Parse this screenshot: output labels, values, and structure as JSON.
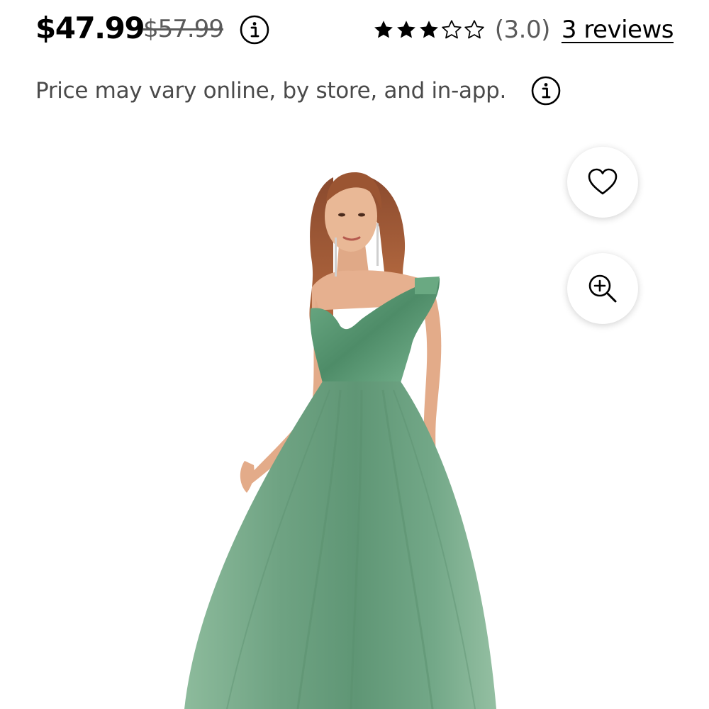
{
  "price": {
    "current": "$47.99",
    "was": "$57.99"
  },
  "rating": {
    "value": 3.0,
    "max": 5,
    "display": "(3.0)",
    "reviews_label": "3 reviews"
  },
  "disclaimer": {
    "text": "Price may vary online, by store, and in-app."
  },
  "icons": {
    "price_info": "info-icon",
    "disclaimer_info": "info-icon",
    "favorite": "heart-icon",
    "zoom": "zoom-in-icon",
    "star_filled": "star-filled-icon",
    "star_empty": "star-outline-icon"
  },
  "colors": {
    "price": "#000000",
    "was_price": "#5a5a5a",
    "secondary_text": "#4a4a4a",
    "dress": "#6fa383",
    "sequin": "#5d9a77",
    "background": "#ffffff"
  }
}
